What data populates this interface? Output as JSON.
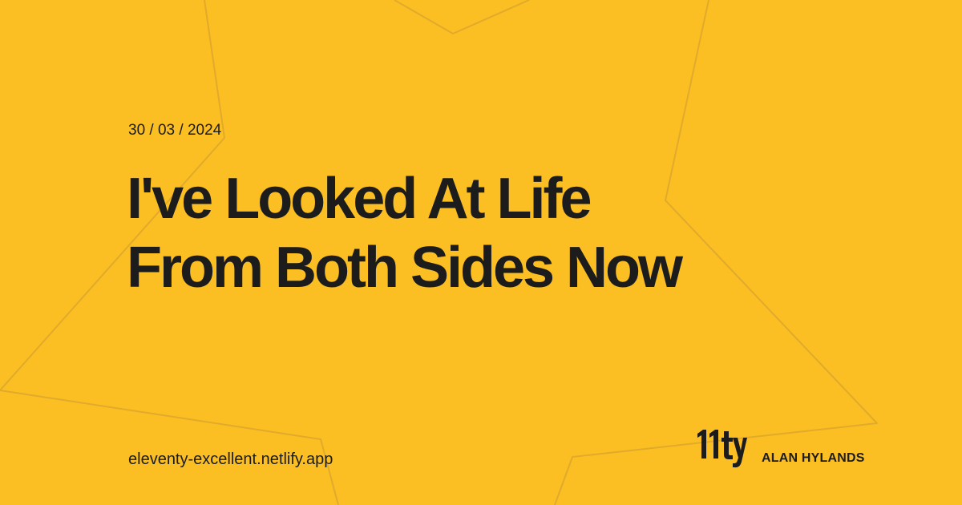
{
  "colors": {
    "background": "#fbbf24",
    "text": "#1c1c1c",
    "star_outline": "#e2aa2a"
  },
  "post": {
    "date": "30 / 03 / 2024",
    "title_lines": [
      "I've Looked At Life",
      "From Both Sides Now"
    ]
  },
  "site": {
    "url": "eleventy-excellent.netlify.app"
  },
  "brand": {
    "logo_text": "11ty",
    "author": "ALAN HYLANDS"
  },
  "decor": {
    "background_shape": "star-outline-icon"
  }
}
